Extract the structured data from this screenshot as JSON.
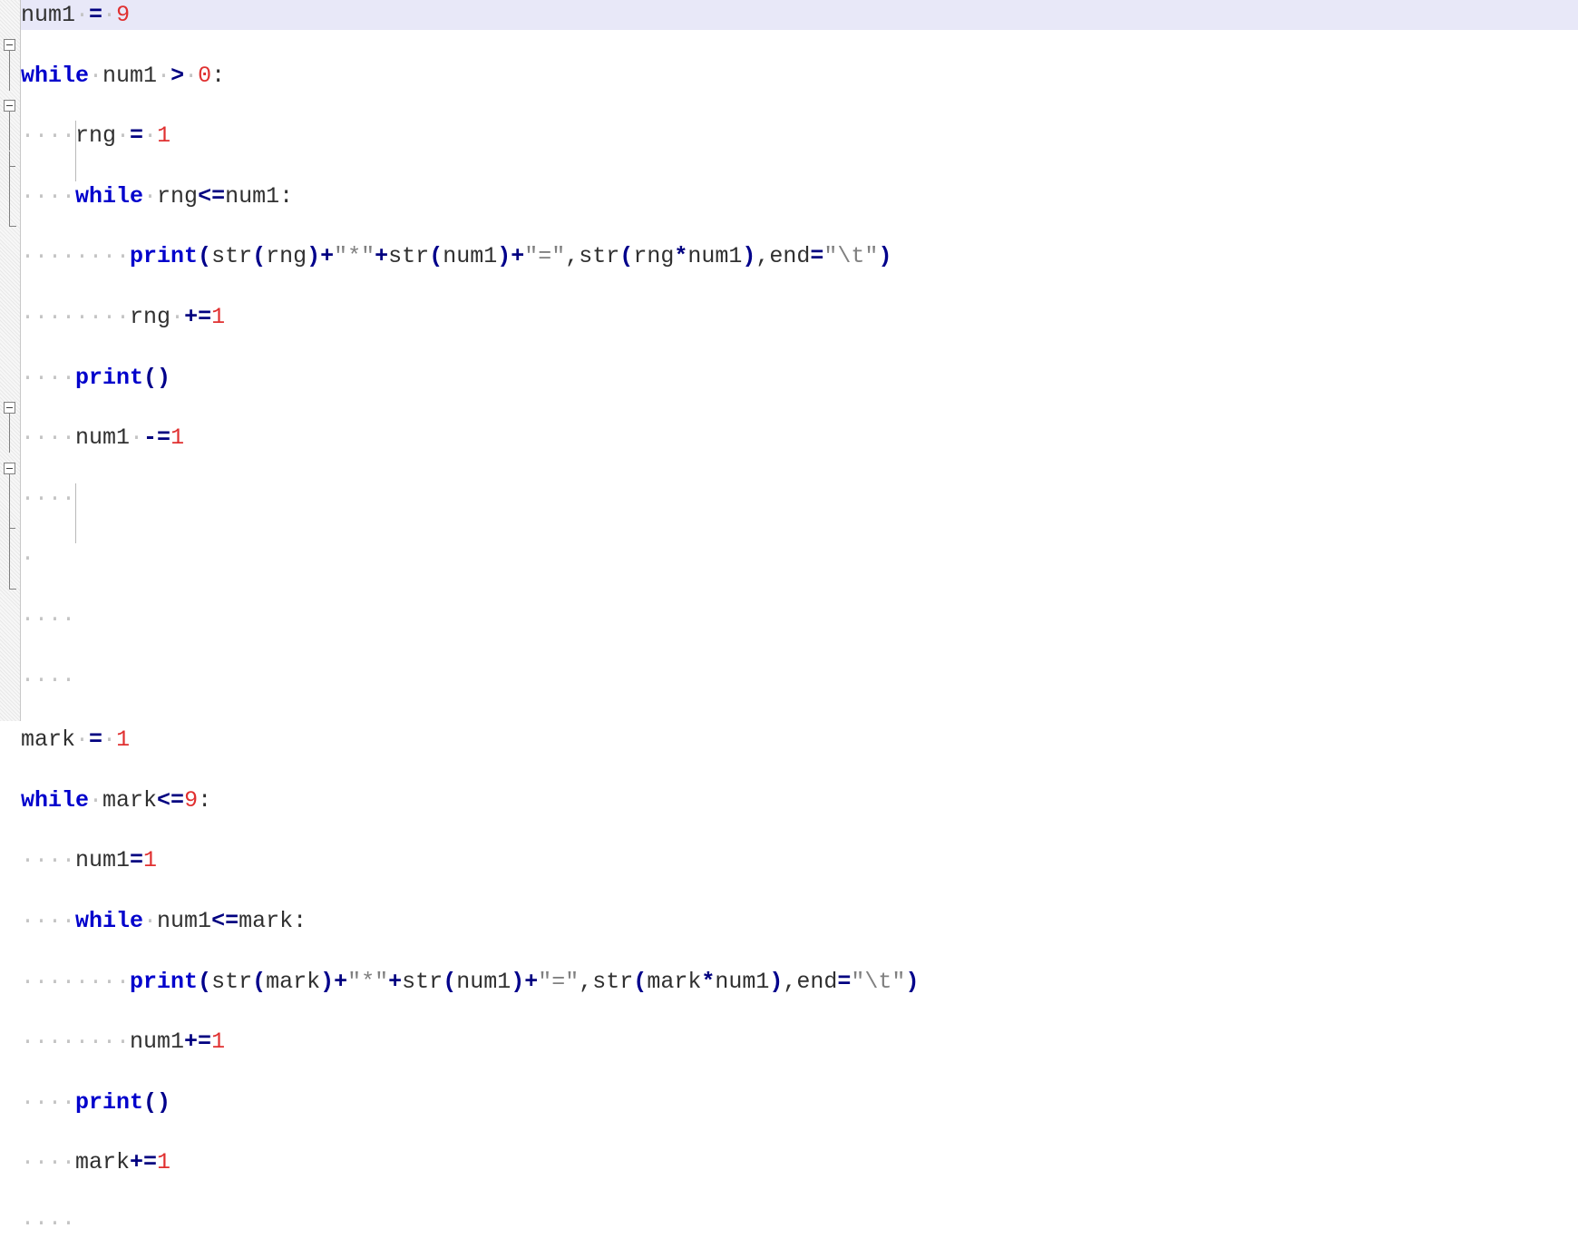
{
  "app": {
    "kind": "python-code-editor",
    "language": "Python"
  },
  "colors": {
    "background": "#ffffff",
    "current_line_highlight": "#e8e8f8",
    "gutter": "#f0f0f0",
    "keyword": "#0000cc",
    "builtin": "#0000cc",
    "operator": "#000080",
    "number": "#e03030",
    "string": "#808080",
    "punctuation": "#00008b",
    "identifier": "#303030",
    "whitespace_dot": "#c4c4c4",
    "indent_guide": "#b9b9b9",
    "fold_marker": "#808080"
  },
  "editor": {
    "whitespace_dot_char": "·",
    "lines": [
      {
        "index": 1,
        "current": true,
        "fold": "none",
        "indent_dots": 0,
        "tokens": [
          {
            "t": "num1",
            "c": "id"
          },
          {
            "t": "·",
            "c": "ws"
          },
          {
            "t": "=",
            "c": "op"
          },
          {
            "t": "·",
            "c": "ws"
          },
          {
            "t": "9",
            "c": "num"
          }
        ],
        "text": "num1 = 9"
      },
      {
        "index": 2,
        "current": false,
        "fold": "open",
        "indent_dots": 0,
        "tokens": [
          {
            "t": "while",
            "c": "kw"
          },
          {
            "t": "·",
            "c": "ws"
          },
          {
            "t": "num1",
            "c": "id"
          },
          {
            "t": "·",
            "c": "ws"
          },
          {
            "t": ">",
            "c": "op"
          },
          {
            "t": "·",
            "c": "ws"
          },
          {
            "t": "0",
            "c": "num"
          },
          {
            "t": ":",
            "c": "id"
          }
        ],
        "text": "while num1 > 0:"
      },
      {
        "index": 3,
        "current": false,
        "fold": "bar",
        "indent_dots": 4,
        "tokens": [
          {
            "t": "rng",
            "c": "id"
          },
          {
            "t": "·",
            "c": "ws"
          },
          {
            "t": "=",
            "c": "op"
          },
          {
            "t": "·",
            "c": "ws"
          },
          {
            "t": "1",
            "c": "num"
          }
        ],
        "text": "    rng = 1"
      },
      {
        "index": 4,
        "current": false,
        "fold": "open",
        "indent_dots": 4,
        "tokens": [
          {
            "t": "while",
            "c": "kw"
          },
          {
            "t": "·",
            "c": "ws"
          },
          {
            "t": "rng",
            "c": "id"
          },
          {
            "t": "<=",
            "c": "op"
          },
          {
            "t": "num1",
            "c": "id"
          },
          {
            "t": ":",
            "c": "id"
          }
        ],
        "text": "    while rng<=num1:"
      },
      {
        "index": 5,
        "current": false,
        "fold": "bar",
        "indent_dots": 8,
        "tokens": [
          {
            "t": "print",
            "c": "bi"
          },
          {
            "t": "(",
            "c": "pun"
          },
          {
            "t": "str",
            "c": "id"
          },
          {
            "t": "(",
            "c": "pun"
          },
          {
            "t": "rng",
            "c": "id"
          },
          {
            "t": ")",
            "c": "pun"
          },
          {
            "t": "+",
            "c": "op"
          },
          {
            "t": "\"*\"",
            "c": "str"
          },
          {
            "t": "+",
            "c": "op"
          },
          {
            "t": "str",
            "c": "id"
          },
          {
            "t": "(",
            "c": "pun"
          },
          {
            "t": "num1",
            "c": "id"
          },
          {
            "t": ")",
            "c": "pun"
          },
          {
            "t": "+",
            "c": "op"
          },
          {
            "t": "\"=\"",
            "c": "str"
          },
          {
            "t": ",",
            "c": "id"
          },
          {
            "t": "str",
            "c": "id"
          },
          {
            "t": "(",
            "c": "pun"
          },
          {
            "t": "rng",
            "c": "id"
          },
          {
            "t": "*",
            "c": "op"
          },
          {
            "t": "num1",
            "c": "id"
          },
          {
            "t": ")",
            "c": "pun"
          },
          {
            "t": ",",
            "c": "id"
          },
          {
            "t": "end",
            "c": "id"
          },
          {
            "t": "=",
            "c": "op"
          },
          {
            "t": "\"\\t\"",
            "c": "str"
          },
          {
            "t": ")",
            "c": "pun"
          }
        ],
        "text": "        print(str(rng)+\"*\"+str(num1)+\"=\",str(rng*num1),end=\"\\t\")"
      },
      {
        "index": 6,
        "current": false,
        "fold": "tick",
        "indent_dots": 8,
        "tokens": [
          {
            "t": "rng",
            "c": "id"
          },
          {
            "t": "·",
            "c": "ws"
          },
          {
            "t": "+=",
            "c": "op"
          },
          {
            "t": "1",
            "c": "num"
          }
        ],
        "text": "        rng +=1"
      },
      {
        "index": 7,
        "current": false,
        "fold": "bar",
        "indent_dots": 4,
        "tokens": [
          {
            "t": "print",
            "c": "bi"
          },
          {
            "t": "()",
            "c": "pun"
          }
        ],
        "text": "    print()"
      },
      {
        "index": 8,
        "current": false,
        "fold": "end",
        "indent_dots": 4,
        "tokens": [
          {
            "t": "num1",
            "c": "id"
          },
          {
            "t": "·",
            "c": "ws"
          },
          {
            "t": "-=",
            "c": "op"
          },
          {
            "t": "1",
            "c": "num"
          }
        ],
        "text": "    num1 -=1"
      },
      {
        "index": 9,
        "current": false,
        "fold": "none",
        "indent_dots": 4,
        "tokens": [],
        "text": "    "
      },
      {
        "index": 10,
        "current": false,
        "fold": "none",
        "indent_dots": 1,
        "tokens": [],
        "text": " "
      },
      {
        "index": 11,
        "current": false,
        "fold": "none",
        "indent_dots": 4,
        "tokens": [],
        "text": "    "
      },
      {
        "index": 12,
        "current": false,
        "fold": "none",
        "indent_dots": 4,
        "tokens": [],
        "text": "    "
      },
      {
        "index": 13,
        "current": false,
        "fold": "none",
        "indent_dots": 0,
        "tokens": [
          {
            "t": "mark",
            "c": "id"
          },
          {
            "t": "·",
            "c": "ws"
          },
          {
            "t": "=",
            "c": "op"
          },
          {
            "t": "·",
            "c": "ws"
          },
          {
            "t": "1",
            "c": "num"
          }
        ],
        "text": "mark = 1"
      },
      {
        "index": 14,
        "current": false,
        "fold": "open",
        "indent_dots": 0,
        "tokens": [
          {
            "t": "while",
            "c": "kw"
          },
          {
            "t": "·",
            "c": "ws"
          },
          {
            "t": "mark",
            "c": "id"
          },
          {
            "t": "<=",
            "c": "op"
          },
          {
            "t": "9",
            "c": "num"
          },
          {
            "t": ":",
            "c": "id"
          }
        ],
        "text": "while mark<=9:"
      },
      {
        "index": 15,
        "current": false,
        "fold": "bar",
        "indent_dots": 4,
        "tokens": [
          {
            "t": "num1",
            "c": "id"
          },
          {
            "t": "=",
            "c": "op"
          },
          {
            "t": "1",
            "c": "num"
          }
        ],
        "text": "    num1=1"
      },
      {
        "index": 16,
        "current": false,
        "fold": "open",
        "indent_dots": 4,
        "tokens": [
          {
            "t": "while",
            "c": "kw"
          },
          {
            "t": "·",
            "c": "ws"
          },
          {
            "t": "num1",
            "c": "id"
          },
          {
            "t": "<=",
            "c": "op"
          },
          {
            "t": "mark",
            "c": "id"
          },
          {
            "t": ":",
            "c": "id"
          }
        ],
        "text": "    while num1<=mark:"
      },
      {
        "index": 17,
        "current": false,
        "fold": "bar",
        "indent_dots": 8,
        "tokens": [
          {
            "t": "print",
            "c": "bi"
          },
          {
            "t": "(",
            "c": "pun"
          },
          {
            "t": "str",
            "c": "id"
          },
          {
            "t": "(",
            "c": "pun"
          },
          {
            "t": "mark",
            "c": "id"
          },
          {
            "t": ")",
            "c": "pun"
          },
          {
            "t": "+",
            "c": "op"
          },
          {
            "t": "\"*\"",
            "c": "str"
          },
          {
            "t": "+",
            "c": "op"
          },
          {
            "t": "str",
            "c": "id"
          },
          {
            "t": "(",
            "c": "pun"
          },
          {
            "t": "num1",
            "c": "id"
          },
          {
            "t": ")",
            "c": "pun"
          },
          {
            "t": "+",
            "c": "op"
          },
          {
            "t": "\"=\"",
            "c": "str"
          },
          {
            "t": ",",
            "c": "id"
          },
          {
            "t": "str",
            "c": "id"
          },
          {
            "t": "(",
            "c": "pun"
          },
          {
            "t": "mark",
            "c": "id"
          },
          {
            "t": "*",
            "c": "op"
          },
          {
            "t": "num1",
            "c": "id"
          },
          {
            "t": ")",
            "c": "pun"
          },
          {
            "t": ",",
            "c": "id"
          },
          {
            "t": "end",
            "c": "id"
          },
          {
            "t": "=",
            "c": "op"
          },
          {
            "t": "\"\\t\"",
            "c": "str"
          },
          {
            "t": ")",
            "c": "pun"
          }
        ],
        "text": "        print(str(mark)+\"*\"+str(num1)+\"=\",str(mark*num1),end=\"\\t\")"
      },
      {
        "index": 18,
        "current": false,
        "fold": "tick",
        "indent_dots": 8,
        "tokens": [
          {
            "t": "num1",
            "c": "id"
          },
          {
            "t": "+=",
            "c": "op"
          },
          {
            "t": "1",
            "c": "num"
          }
        ],
        "text": "        num1+=1"
      },
      {
        "index": 19,
        "current": false,
        "fold": "bar",
        "indent_dots": 4,
        "tokens": [
          {
            "t": "print",
            "c": "bi"
          },
          {
            "t": "()",
            "c": "pun"
          }
        ],
        "text": "    print()"
      },
      {
        "index": 20,
        "current": false,
        "fold": "end",
        "indent_dots": 4,
        "tokens": [
          {
            "t": "mark",
            "c": "id"
          },
          {
            "t": "+=",
            "c": "op"
          },
          {
            "t": "1",
            "c": "num"
          }
        ],
        "text": "    mark+=1"
      },
      {
        "index": 21,
        "current": false,
        "fold": "none",
        "indent_dots": 4,
        "tokens": [],
        "text": "    "
      }
    ],
    "indent_guides": [
      {
        "col": 4,
        "from_line": 5,
        "to_line": 6
      },
      {
        "col": 4,
        "from_line": 17,
        "to_line": 18
      }
    ]
  }
}
